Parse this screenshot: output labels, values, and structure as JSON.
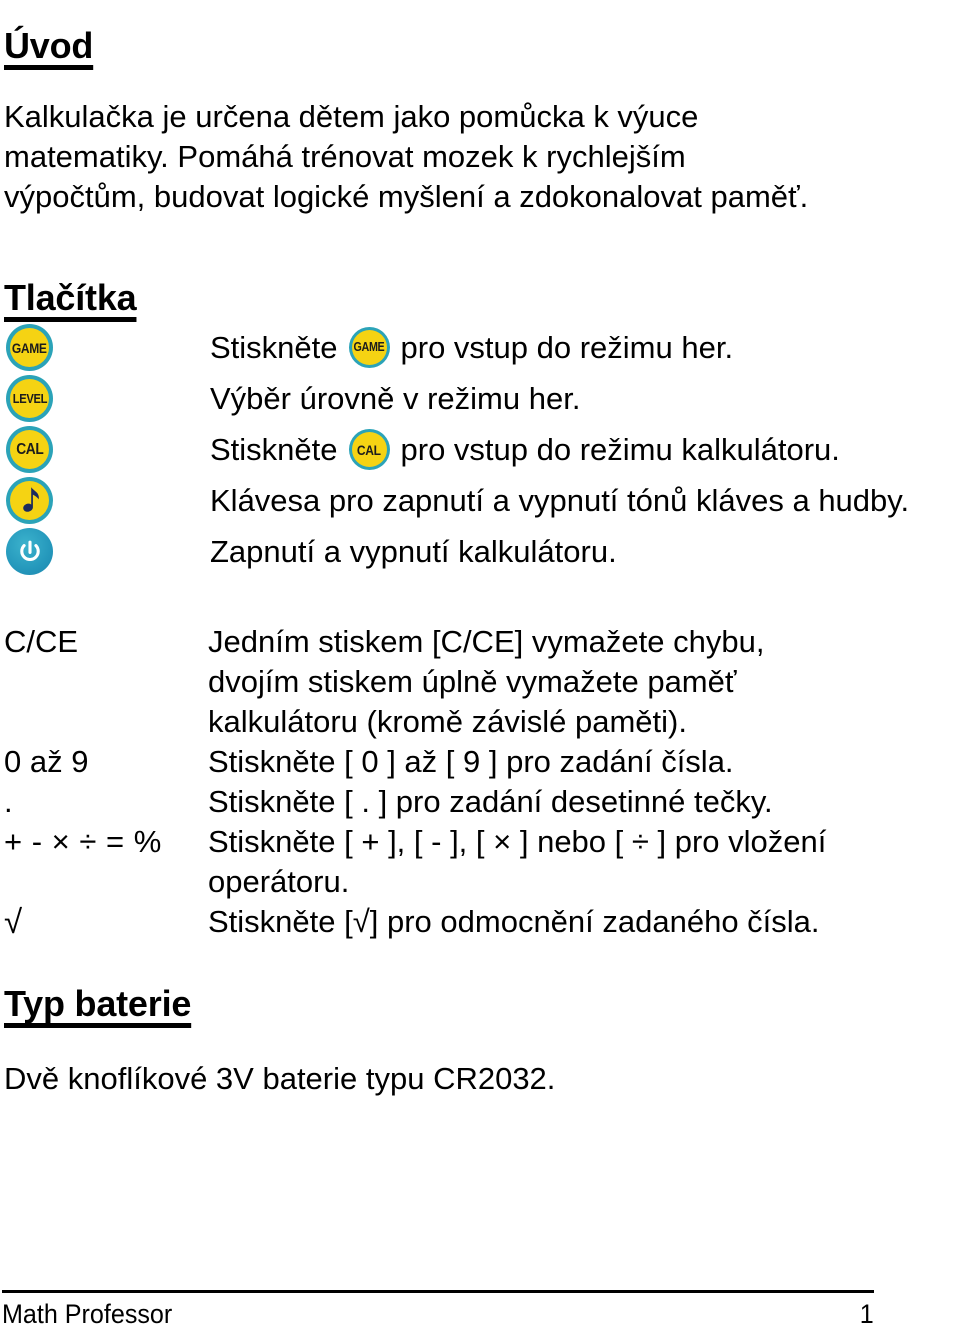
{
  "document": {
    "sections": {
      "intro": {
        "heading": "Úvod",
        "paragraph": "Kalkulačka je určena dětem jako pomůcka k výuce matematiky. Pomáhá trénovat mozek k rychlejším výpočtům, budovat logické myšlení a zdokonalovat paměť."
      },
      "buttons": {
        "heading": "Tlačítka",
        "icons": [
          {
            "name": "game-key-icon",
            "label": "GAME",
            "style": "ring"
          },
          {
            "name": "level-key-icon",
            "label": "LEVEL",
            "style": "ring"
          },
          {
            "name": "cal-key-icon",
            "label": "CAL",
            "style": "ring"
          },
          {
            "name": "music-note-key-icon",
            "label": "♪",
            "style": "ring-note"
          },
          {
            "name": "power-key-icon",
            "label": "⏻",
            "style": "solid-power"
          }
        ],
        "rows": [
          {
            "before": "Stiskněte",
            "icon": "GAME",
            "after": "pro vstup do režimu her."
          },
          {
            "before": "Výběr úrovně v režimu her.",
            "icon": "",
            "after": ""
          },
          {
            "before": "Stiskněte",
            "icon": "CAL",
            "after": "pro vstup do režimu kalkulátoru."
          },
          {
            "before": "Klávesa pro zapnutí a vypnutí tónů kláves a hudby.",
            "icon": "",
            "after": ""
          },
          {
            "before": "Zapnutí a vypnutí kalkulátoru.",
            "icon": "",
            "after": ""
          }
        ]
      },
      "key_table": {
        "rows": [
          {
            "symbol": "C/CE",
            "lines": [
              "Jedním stiskem [C/CE] vymažete chybu,",
              "dvojím stiskem úplně vymažete paměť",
              "kalkulátoru (kromě závislé paměti)."
            ]
          },
          {
            "symbol": "0 až 9",
            "lines": [
              "Stiskněte [ 0 ] až [ 9 ] pro zadání čísla."
            ]
          },
          {
            "symbol": ".",
            "lines": [
              "Stiskněte [ . ] pro zadání desetinné tečky."
            ]
          },
          {
            "symbol": "+ - × ÷ = %",
            "lines": [
              "Stiskněte [ + ], [ - ], [ × ] nebo [ ÷ ] pro vložení",
              "operátoru."
            ]
          },
          {
            "symbol": "√",
            "lines": [
              "Stiskněte [√] pro odmocnění zadaného čísla."
            ]
          }
        ]
      },
      "battery": {
        "heading": "Typ baterie",
        "text": "Dvě knoflíkové 3V baterie typu CR2032."
      }
    },
    "footer": {
      "left": "Math Professor",
      "page_number": "1"
    },
    "colors": {
      "icon_ring": "#2ba3b8",
      "icon_fill": "#f5d313",
      "icon_power": "#2a9fc0",
      "text": "#000000",
      "background": "#ffffff"
    }
  }
}
